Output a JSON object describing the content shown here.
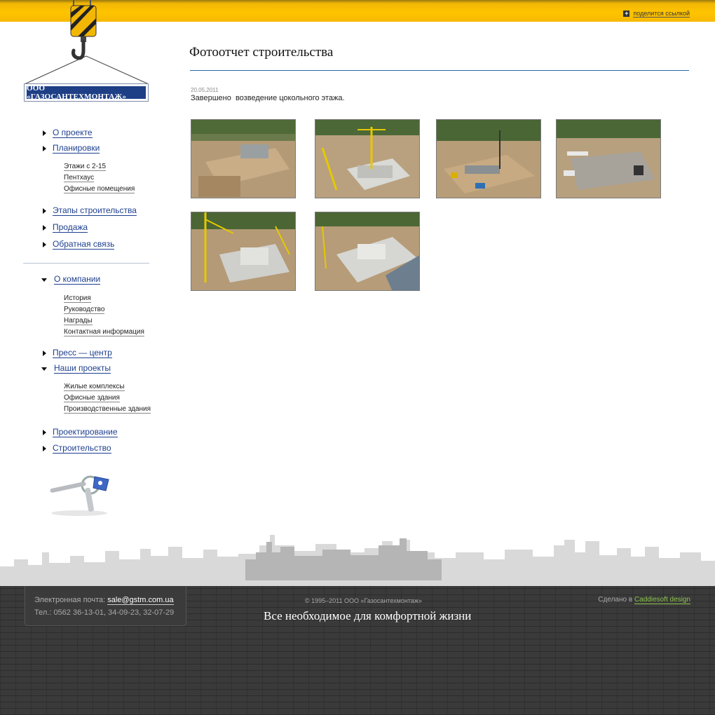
{
  "header": {
    "share_label": "поделится ссылкой"
  },
  "logo": {
    "company": "ООО «ГАЗОСАНТЕХМОНТАЖ»"
  },
  "menu": {
    "items": [
      {
        "label": "О проекте"
      },
      {
        "label": "Планировки"
      },
      {
        "label": "Этапы строительства"
      },
      {
        "label": "Продажа"
      },
      {
        "label": "Обратная связь"
      },
      {
        "label": "О компании"
      },
      {
        "label": "Пресс — центр"
      },
      {
        "label": "Наши проекты"
      },
      {
        "label": "Проектирование"
      },
      {
        "label": "Строительство"
      }
    ],
    "planning_sub": [
      "Этажи с 2-15",
      "Пентхаус",
      "Офисные помещения"
    ],
    "company_sub": [
      "История",
      "Руководство",
      "Награды",
      "Контактная информация"
    ],
    "projects_sub": [
      "Жилые комплексы",
      "Офисные здания",
      "Производственные здания"
    ]
  },
  "main": {
    "title": "Фотоотчет строительства",
    "date": "20,05,2011",
    "description": "Завершено  возведение цокольного этажа."
  },
  "footer": {
    "email_label": "Электронная почта: ",
    "email": "sale@gstm.com.ua",
    "phones": "Тел.: 0562 36-13-01, 34-09-23, 32-07-29",
    "copyright": "© 1995–2011 ООО «Газосантехмонтаж»",
    "slogan": "Все необходимое для комфортной жизни",
    "made_by_label": "Сделано в ",
    "made_by_link": "Caddiesoft design"
  },
  "colors": {
    "accent_yellow": "#ffc400",
    "link_blue": "#1d3f8f",
    "logo_blue": "#1e3f86",
    "footer_dark": "#3a3a3a",
    "credit_green": "#8bc34a"
  }
}
